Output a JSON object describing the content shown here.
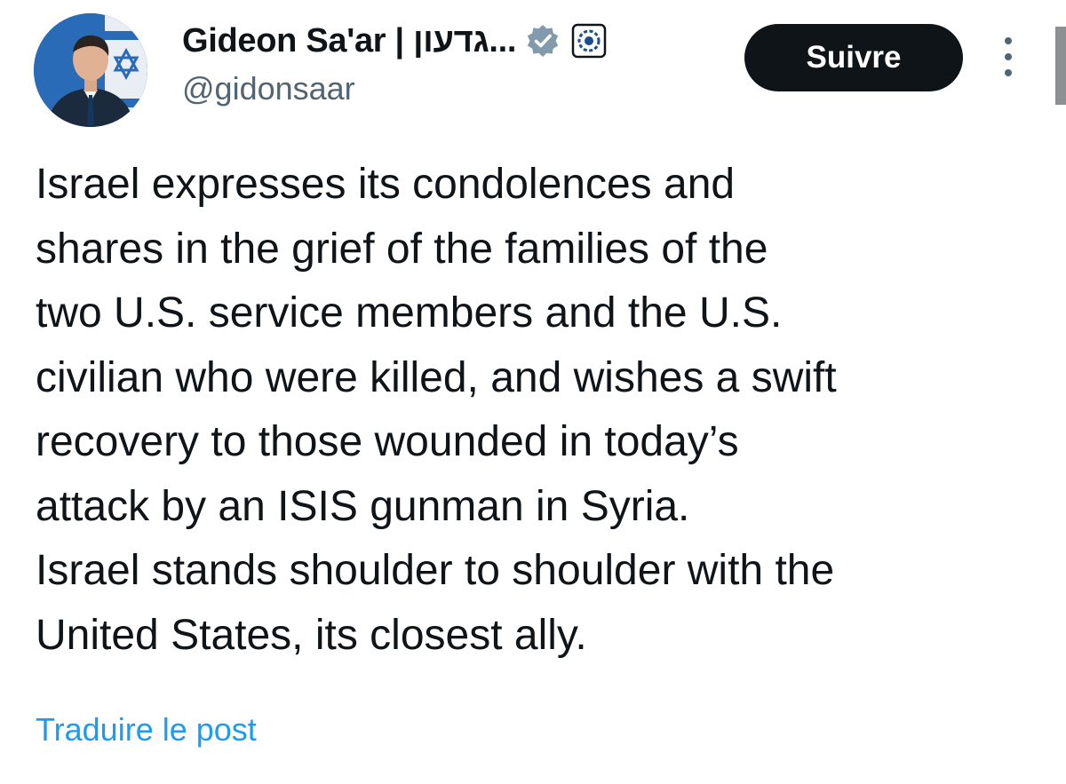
{
  "author": {
    "display_name": "Gideon Sa'ar | גדעון...",
    "handle": "@gidonsaar",
    "avatar_icon": "profile-photo-with-israel-flag",
    "verified_badge_icon": "verified-badge-icon",
    "affiliate_badge_icon": "government-emblem-icon"
  },
  "actions": {
    "follow_label": "Suivre",
    "more_icon": "more-vertical-icon"
  },
  "post": {
    "lines": [
      "Israel expresses its condolences and",
      "shares in the grief of the families of the",
      "two U.S. service members and the U.S.",
      "civilian who were killed, and wishes a swift",
      "recovery to those wounded in today’s",
      "attack by an ISIS gunman in Syria.",
      "Israel stands shoulder to shoulder with the",
      "United States, its closest ally."
    ]
  },
  "footer": {
    "translate_label": "Traduire le post"
  },
  "colors": {
    "text_primary": "#0f1419",
    "text_secondary": "#536471",
    "link": "#1d9bf0",
    "button_bg": "#0f1419",
    "button_text": "#ffffff",
    "verified_badge": "#829aab"
  }
}
